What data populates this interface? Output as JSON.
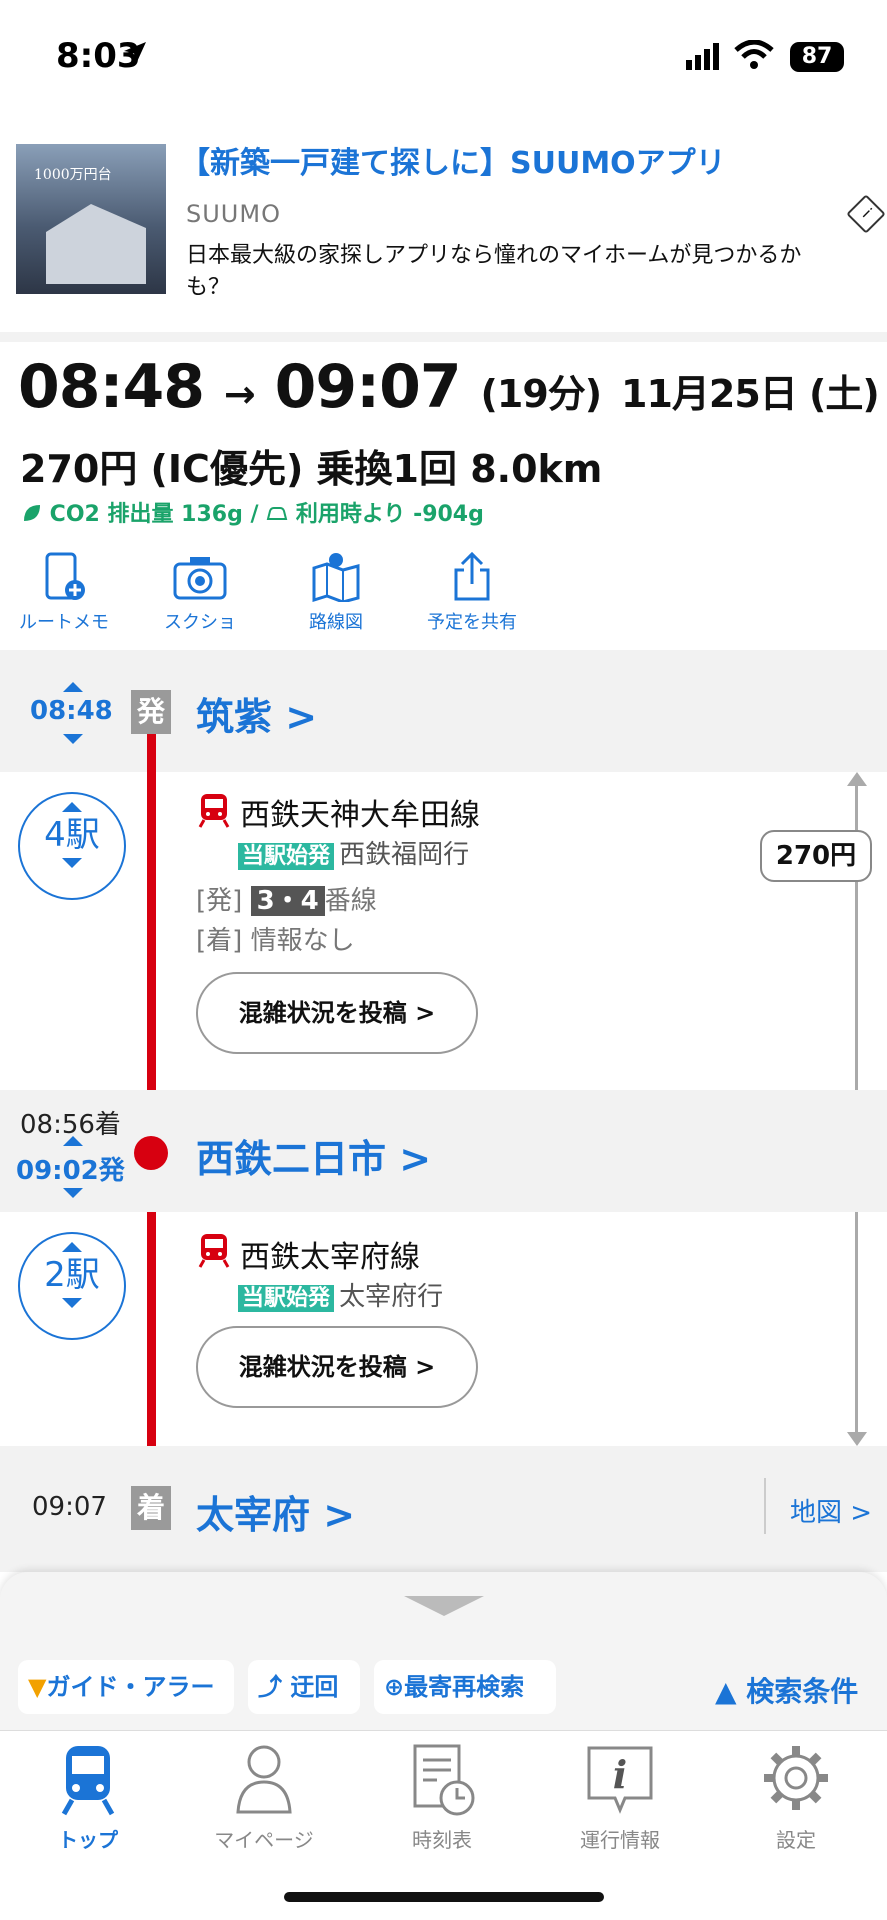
{
  "status_bar": {
    "time": "8:03",
    "battery": "87"
  },
  "ad": {
    "title": "【新築一戸建て探しに】SUUMOアプリ",
    "brand": "SUUMO",
    "description": "日本最大級の家探しアプリなら憧れのマイホームが見つかるかも？",
    "image_caption": "1000万円台"
  },
  "summary": {
    "depart": "08:48",
    "arrow": "→",
    "arrive": "09:07",
    "duration": "(19分)",
    "date": "11月25日 (土)",
    "fare_line": "270円 (IC優先) 乗換1回 8.0km",
    "co2": "CO2 排出量 136g / ",
    "co2_car": "利用時より -904g"
  },
  "actions": [
    {
      "label": "ルートメモ",
      "icon": "phone-plus-icon"
    },
    {
      "label": "スクショ",
      "icon": "camera-icon"
    },
    {
      "label": "路線図",
      "icon": "map-pin-icon"
    },
    {
      "label": "予定を共有",
      "icon": "share-icon"
    }
  ],
  "route": {
    "origin": {
      "time": "08:48",
      "badge": "発",
      "name": "筑紫 >"
    },
    "leg1": {
      "stops": "4駅",
      "line": "西鉄天神大牟田線",
      "tag": "当駅始発",
      "dest": "西鉄福岡行",
      "dep_prefix": "[発]",
      "platform": "3・4",
      "platform_suffix": "番線",
      "arr_prefix": "[着]",
      "arr_info": "情報なし",
      "crowd_button": "混雑状況を投稿 >"
    },
    "transfer": {
      "arr_time": "08:56着",
      "dep_time": "09:02発",
      "name": "西鉄二日市 >"
    },
    "leg2": {
      "stops": "2駅",
      "line": "西鉄太宰府線",
      "tag": "当駅始発",
      "dest": "太宰府行",
      "crowd_button": "混雑状況を投稿 >"
    },
    "destination": {
      "time": "09:07",
      "badge": "着",
      "name": "太宰府 >",
      "map_link": "地図 >"
    },
    "fare": "270円"
  },
  "sheet": {
    "chips": [
      "ガイド・アラーム",
      "迂回",
      "最寄再検索"
    ],
    "conditions": "▲ 検索条件"
  },
  "tabs": [
    {
      "label": "トップ",
      "icon": "train-icon",
      "active": true
    },
    {
      "label": "マイページ",
      "icon": "person-icon",
      "active": false
    },
    {
      "label": "時刻表",
      "icon": "timetable-icon",
      "active": false
    },
    {
      "label": "運行情報",
      "icon": "info-icon",
      "active": false
    },
    {
      "label": "設定",
      "icon": "gear-icon",
      "active": false
    }
  ],
  "colors": {
    "accent": "#1b74d6",
    "line_red": "#d70010",
    "teal": "#2cb8a0",
    "eco_green": "#1aa36a"
  }
}
